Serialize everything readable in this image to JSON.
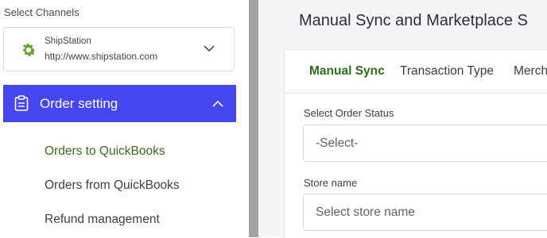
{
  "sidebar": {
    "select_channels_label": "Select Channels",
    "channel": {
      "name": "ShipStation",
      "url": "http://www.shipstation.com",
      "icon": "gear-icon"
    },
    "order_setting": {
      "label": "Order setting",
      "icon": "clipboard-icon"
    },
    "submenu": [
      {
        "label": "Orders to QuickBooks",
        "active": true
      },
      {
        "label": "Orders from QuickBooks",
        "active": false
      },
      {
        "label": "Refund management",
        "active": false
      }
    ]
  },
  "main": {
    "title": "Manual Sync and Marketplace S",
    "tabs": [
      {
        "label": "Manual Sync",
        "active": true
      },
      {
        "label": "Transaction Type",
        "active": false
      },
      {
        "label": "Merch",
        "active": false
      }
    ],
    "order_status": {
      "label": "Select Order Status",
      "value": "-Select-"
    },
    "store_name": {
      "label": "Store name",
      "placeholder": "Select store name"
    }
  },
  "colors": {
    "accent": "#4646f0",
    "active_green": "#3a6a1f",
    "channel_icon": "#6aa332"
  }
}
